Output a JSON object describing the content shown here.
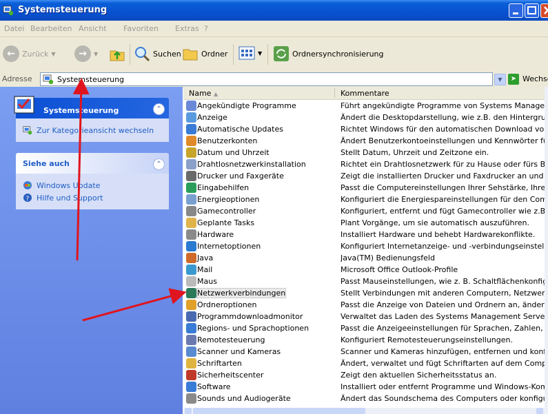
{
  "window": {
    "title": "Systemsteuerung"
  },
  "menu": [
    "Datei",
    "Bearbeiten",
    "Ansicht",
    "Favoriten",
    "Extras",
    "?"
  ],
  "toolbar": {
    "back": "Zurück",
    "search": "Suchen",
    "folders": "Ordner",
    "sync": "Ordnersynchronisierung"
  },
  "address": {
    "label": "Adresse",
    "value": "Systemsteuerung",
    "go": "Wechseln zu"
  },
  "sidebar": {
    "main_title": "Systemsteuerung",
    "switch_link": "Zur Kategorieansicht wechseln",
    "see_also_title": "Siehe auch",
    "links": [
      "Windows Update",
      "Hilfe und Support"
    ]
  },
  "columns": {
    "name": "Name",
    "comment": "Kommentare"
  },
  "items": [
    {
      "name": "Angekündigte Programme",
      "comment": "Führt angekündigte Programme von Systems Management Se"
    },
    {
      "name": "Anzeige",
      "comment": "Ändert die Desktopdarstellung, wie z.B. den Hintergrund, Bilds"
    },
    {
      "name": "Automatische Updates",
      "comment": "Richtet Windows für den automatischen Download von wichtig"
    },
    {
      "name": "Benutzerkonten",
      "comment": "Ändert Benutzerkontoeinstellungen und Kennwörter für Perso"
    },
    {
      "name": "Datum und Uhrzeit",
      "comment": "Stellt Datum, Uhrzeit und Zeitzone ein."
    },
    {
      "name": "Drahtlosnetzwerkinstallation",
      "comment": "Richtet ein Drahtlosnetzwerk für zu Hause oder fürs Büro ein."
    },
    {
      "name": "Drucker und Faxgeräte",
      "comment": "Zeigt die installierten Drucker und Faxdrucker an und unterstü"
    },
    {
      "name": "Eingabehilfen",
      "comment": "Passt die Computereinstellungen Ihrer Sehstärke, Ihrem Gehö"
    },
    {
      "name": "Energieoptionen",
      "comment": "Konfiguriert die Energiespareinstellungen für den Computer."
    },
    {
      "name": "Gamecontroller",
      "comment": "Konfiguriert, entfernt und fügt Gamecontroller wie z.B. Joystic"
    },
    {
      "name": "Geplante Tasks",
      "comment": "Plant Vorgänge, um sie automatisch auszuführen."
    },
    {
      "name": "Hardware",
      "comment": "Installiert Hardware und behebt Hardwarekonflikte."
    },
    {
      "name": "Internetoptionen",
      "comment": "Konfiguriert Internetanzeige- und -verbindungseinstellungen."
    },
    {
      "name": "Java",
      "comment": "Java(TM) Bedienungsfeld"
    },
    {
      "name": "Mail",
      "comment": "Microsoft Office Outlook-Profile"
    },
    {
      "name": "Maus",
      "comment": "Passt Mauseinstellungen, wie z. B. Schaltflächenkonfiguration,"
    },
    {
      "name": "Netzwerkverbindungen",
      "comment": "Stellt Verbindungen mit anderen Computern, Netzwerken oder"
    },
    {
      "name": "Ordneroptionen",
      "comment": "Passt die Anzeige von Dateien und Ordnern an, ändert Dateiz"
    },
    {
      "name": "Programmdownloadmonitor",
      "comment": "Verwaltet das Laden des Systems Management Server-Progra"
    },
    {
      "name": "Regions- und Sprachoptionen",
      "comment": "Passt die Anzeigeeinstellungen für Sprachen, Zahlen, Währun"
    },
    {
      "name": "Remotesteuerung",
      "comment": "Konfiguriert Remotesteuerungseinstellungen."
    },
    {
      "name": "Scanner und Kameras",
      "comment": "Scanner und Kameras hinzufügen, entfernen und konfiguriere"
    },
    {
      "name": "Schriftarten",
      "comment": "Ändert, verwaltet und fügt Schriftarten auf dem Computer hir"
    },
    {
      "name": "Sicherheitscenter",
      "comment": "Zeigt den aktuellen Sicherheitsstatus an."
    },
    {
      "name": "Software",
      "comment": "Installiert oder entfernt Programme und Windows-Komponent"
    },
    {
      "name": "Sounds und Audiogeräte",
      "comment": "Ändert das Soundschema des Computers oder konfiguriert die"
    }
  ],
  "selected_item": "Netzwerkverbindungen",
  "colors": {
    "titlebar": "#0a5fd8",
    "sidebar": "#6f90ea",
    "link": "#215dc6",
    "arrow": "#e0141e"
  }
}
